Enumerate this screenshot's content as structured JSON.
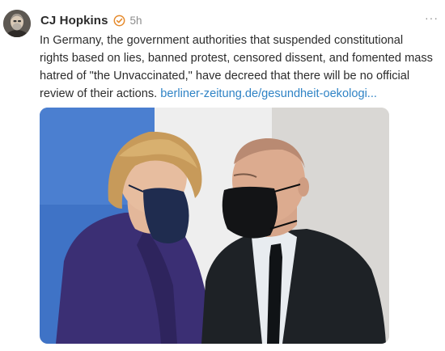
{
  "post": {
    "author": "CJ Hopkins",
    "timestamp": "5h",
    "more_label": "···",
    "body_text": "In Germany, the government authorities that suspended constitutional rights based on lies, banned protest, censored dissent, and fomented mass hatred of \"the Unvaccinated,\" have decreed that there will be no official review of their actions. ",
    "link_text": "berliner-zeitung.de/gesundheit-oekologi...",
    "verified_badge_color": "#e58a2c",
    "link_color": "#2f83c5",
    "avatar_icon": "user-avatar",
    "badge_icon": "verified-check-icon",
    "more_icon": "more-options-icon"
  }
}
